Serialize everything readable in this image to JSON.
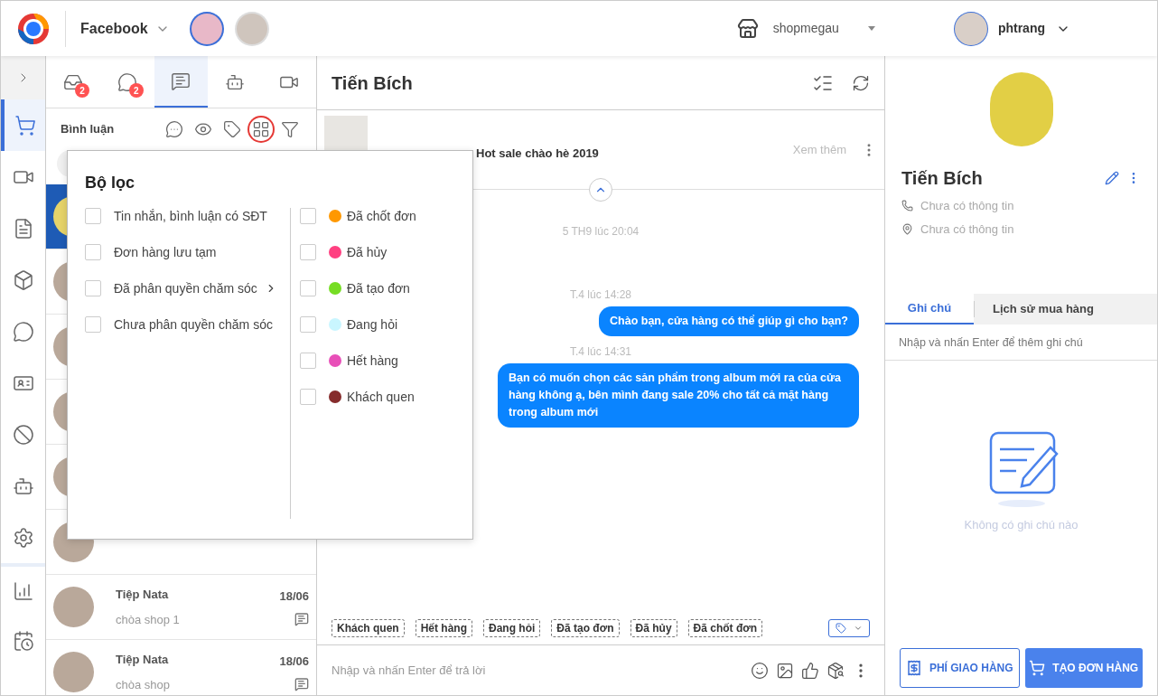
{
  "topbar": {
    "channel": "Facebook",
    "pages": [
      {
        "selected": true
      },
      {
        "selected": false
      }
    ],
    "shop": "shopmegau",
    "user": "phtrang"
  },
  "rail": [
    {
      "kind": "toggle",
      "selected": false
    },
    {
      "kind": "cart",
      "selected": true
    },
    {
      "kind": "video",
      "selected": false
    },
    {
      "kind": "note",
      "selected": false
    },
    {
      "kind": "box",
      "selected": false
    },
    {
      "kind": "chat",
      "selected": false
    },
    {
      "kind": "card",
      "selected": false
    },
    {
      "kind": "block",
      "selected": false
    },
    {
      "kind": "bot",
      "selected": false
    },
    {
      "kind": "settings",
      "selected": false
    },
    {
      "kind": "chart",
      "selected": false
    },
    {
      "kind": "history",
      "selected": false
    }
  ],
  "list_tabs": [
    {
      "kind": "inbox",
      "badge": "2",
      "selected": false
    },
    {
      "kind": "messenger",
      "badge": "2",
      "selected": false
    },
    {
      "kind": "comment",
      "selected": true
    },
    {
      "kind": "bot",
      "selected": false
    },
    {
      "kind": "video",
      "selected": false
    }
  ],
  "list_header": {
    "title": "Bình luận",
    "tools": [
      {
        "kind": "dots",
        "highlighted": false
      },
      {
        "kind": "eye",
        "highlighted": false
      },
      {
        "kind": "tag",
        "highlighted": false
      },
      {
        "kind": "grid",
        "highlighted": true
      },
      {
        "kind": "filter",
        "highlighted": false
      }
    ]
  },
  "conversations": [
    {
      "selected": true
    },
    {
      "selected": false
    },
    {
      "selected": false
    },
    {
      "selected": false
    },
    {
      "selected": false
    },
    {
      "selected": false
    },
    {
      "selected": false,
      "name": "Tiệp Nata",
      "preview": "chòa shop 1",
      "date": "18/06"
    },
    {
      "selected": false,
      "name": "Tiệp Nata",
      "preview": "chòa shop",
      "date": "18/06"
    }
  ],
  "filter": {
    "title": "Bộ lọc",
    "options": [
      {
        "label": "Tin nhắn, bình luận có SĐT",
        "checked": false,
        "kind": "plain"
      },
      {
        "label": "Đơn hàng lưu tạm",
        "checked": false,
        "kind": "plain"
      },
      {
        "label": "Đã phân quyền chăm sóc",
        "checked": false,
        "kind": "submenu"
      },
      {
        "label": "Chưa phân quyền chăm sóc",
        "checked": false,
        "kind": "plain"
      }
    ],
    "tags": [
      {
        "label": "Đã chốt đơn",
        "color": "#ff9800",
        "checked": false
      },
      {
        "label": "Đã hủy",
        "color": "#ff4081",
        "checked": false
      },
      {
        "label": "Đã tạo đơn",
        "color": "#76dd24",
        "checked": false
      },
      {
        "label": "Đang hỏi",
        "color": "#c9f6ff",
        "checked": false
      },
      {
        "label": "Hết hàng",
        "color": "#e84fb8",
        "checked": false
      },
      {
        "label": "Khách quen",
        "color": "#862c2c",
        "checked": false
      }
    ]
  },
  "chat": {
    "title": "Tiến Bích",
    "post": {
      "text": "Hot sale chào hè 2019",
      "more": "Xem thêm"
    },
    "messages": [
      {
        "kind": "time",
        "text": "5 TH9 lúc 20:04"
      },
      {
        "kind": "time",
        "text": "T.4 lúc 14:28"
      },
      {
        "kind": "out",
        "text": "Chào bạn, cửa hàng có thể giúp gì cho bạn?"
      },
      {
        "kind": "time",
        "text": "T.4 lúc 14:31"
      },
      {
        "kind": "out",
        "text": "Bạn có muốn chọn các sản phẩm trong album mới ra của cửa hàng không ạ, bên mình đang sale 20% cho tất cả mặt hàng trong album mới"
      }
    ],
    "quick_tags": [
      "Khách quen",
      "Hết hàng",
      "Đang hỏi",
      "Đã tạo đơn",
      "Đã hủy",
      "Đã chốt đơn"
    ],
    "composer": {
      "placeholder": "Nhập và nhấn Enter để trả lời"
    }
  },
  "customer": {
    "name": "Tiến Bích",
    "phone": "Chưa có thông tin",
    "address": "Chưa có thông tin",
    "tabs": [
      {
        "label": "Ghi chú",
        "selected": true
      },
      {
        "label": "Lịch sử mua hàng",
        "selected": false
      }
    ],
    "note_placeholder": "Nhập và nhấn Enter để thêm ghi chú",
    "empty": "Không có ghi chú nào",
    "buttons": [
      {
        "label": "PHÍ GIAO HÀNG",
        "kind": "outline"
      },
      {
        "label": "TẠO ĐƠN HÀNG",
        "kind": "primary"
      }
    ]
  }
}
